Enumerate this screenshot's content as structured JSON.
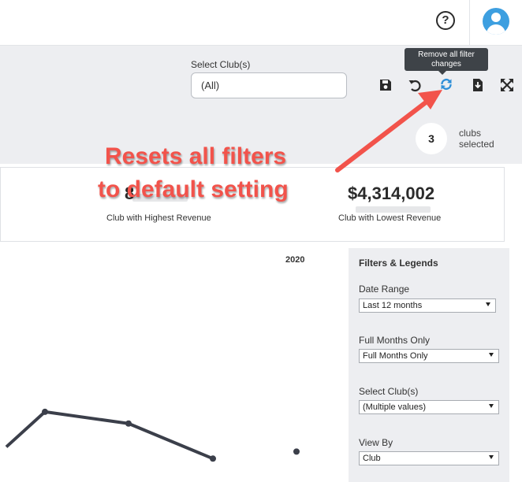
{
  "header": {
    "help_icon": "help-circle-icon",
    "help_glyph": "?",
    "avatar_icon": "user-avatar-icon"
  },
  "filter_bar": {
    "select_label": "Select Club(s)",
    "select_value": "(All)",
    "actions": [
      {
        "name": "save-icon"
      },
      {
        "name": "undo-icon"
      },
      {
        "name": "refresh-icon",
        "active": true
      },
      {
        "name": "download-icon"
      },
      {
        "name": "fullscreen-icon"
      }
    ],
    "tooltip": "Remove all filter changes",
    "clubs_selected_count": "3",
    "clubs_selected_label": "clubs selected"
  },
  "annotation": {
    "line1": "Resets all filters",
    "line2": "to default setting",
    "color": "#f2534b"
  },
  "kpis": {
    "highest": {
      "value_visible": "8",
      "label": "Club with Highest Revenue"
    },
    "lowest": {
      "value": "$4,314,002",
      "label": "Club with Lowest Revenue"
    }
  },
  "chart_data": {
    "type": "line",
    "year_label": "2020",
    "series": [
      {
        "values": [
          1.5,
          3,
          2.5,
          1,
          null
        ]
      },
      {
        "values": [
          null,
          null,
          null,
          null,
          1.3
        ]
      }
    ],
    "ylim": [
      0,
      10
    ]
  },
  "panel": {
    "title": "Filters & Legends",
    "filters": [
      {
        "label": "Date Range",
        "value": "Last 12 months"
      },
      {
        "label": "Full Months Only",
        "value": "Full Months Only"
      },
      {
        "label": "Select Club(s)",
        "value": "(Multiple values)"
      },
      {
        "label": "View By",
        "value": "Club"
      }
    ]
  },
  "colors": {
    "accent": "#3d9fe0",
    "line": "#3b3f4a",
    "panel_bg": "#edeef1"
  }
}
